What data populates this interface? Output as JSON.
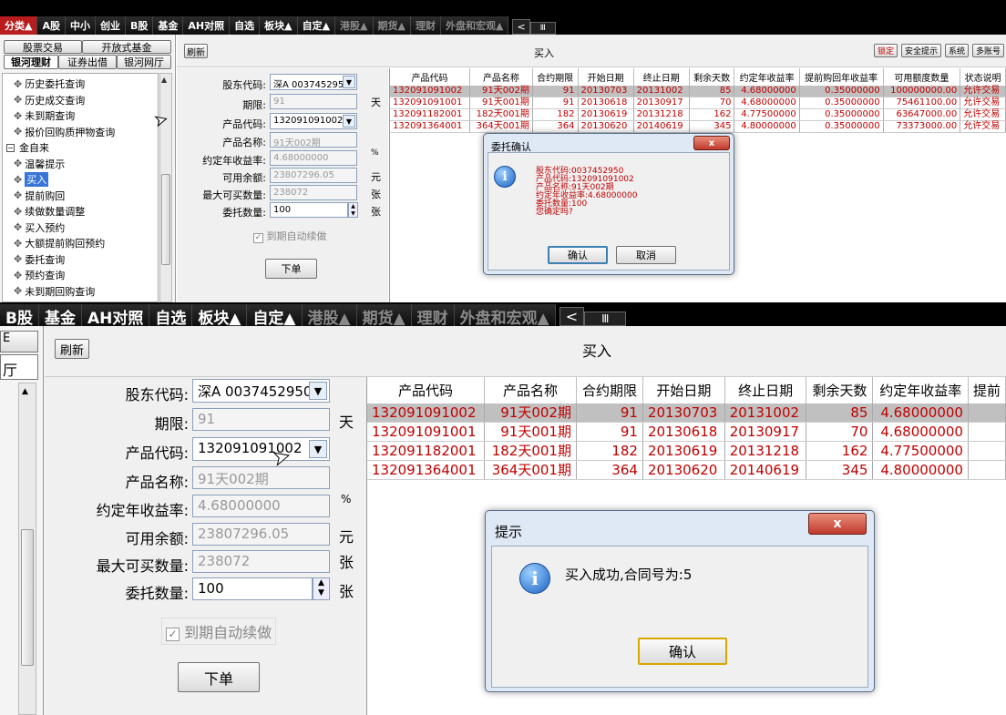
{
  "top": {
    "tabs": [
      {
        "label": "分类▲",
        "active": true
      },
      {
        "label": "A股"
      },
      {
        "label": "中小"
      },
      {
        "label": "创业"
      },
      {
        "label": "B股"
      },
      {
        "label": "基金"
      },
      {
        "label": "AH对照"
      },
      {
        "label": "自选"
      },
      {
        "label": "板块▲"
      },
      {
        "label": "自定▲"
      },
      {
        "label": "港股▲",
        "dim": true
      },
      {
        "label": "期货▲",
        "dim": true
      },
      {
        "label": "理财",
        "dim": true
      },
      {
        "label": "外盘和宏观▲",
        "dim": true
      }
    ],
    "nav_left": "<",
    "nav_mid": "Ⅲ",
    "left_tabs": {
      "row1": [
        "股票交易",
        "开放式基金"
      ],
      "row2": [
        "银河理财",
        "证券出借",
        "银河网厅"
      ]
    },
    "tree": [
      {
        "label": "历史委托查询"
      },
      {
        "label": "历史成交查询"
      },
      {
        "label": "未到期查询"
      },
      {
        "label": "报价回购质押物查询"
      },
      {
        "label": "金自来",
        "group": true
      },
      {
        "label": "温馨提示"
      },
      {
        "label": "买入",
        "selected": true
      },
      {
        "label": "提前购回"
      },
      {
        "label": "续做数量调整"
      },
      {
        "label": "买入预约"
      },
      {
        "label": "大额提前购回预约"
      },
      {
        "label": "委托查询"
      },
      {
        "label": "预约查询"
      },
      {
        "label": "未到期回购查询"
      }
    ],
    "toolbar": {
      "refresh": "刷新",
      "title": "买入",
      "right_buttons": [
        "锁定",
        "安全提示",
        "系统",
        "多账号"
      ]
    },
    "form": {
      "shareholder_label": "股东代码:",
      "shareholder_value": "深A 0037452950",
      "term_label": "期限:",
      "term_value": "91",
      "term_unit": "天",
      "product_code_label": "产品代码:",
      "product_code_value": "132091091002",
      "product_name_label": "产品名称:",
      "product_name_value": "91天002期",
      "rate_label": "约定年收益率:",
      "rate_value": "4.68000000",
      "rate_unit": "%",
      "balance_label": "可用余额:",
      "balance_value": "23807296.05",
      "balance_unit": "元",
      "max_label": "最大可买数量:",
      "max_value": "238072",
      "max_unit": "张",
      "qty_label": "委托数量:",
      "qty_value": "100",
      "qty_unit": "张",
      "auto_renew": "到期自动续做",
      "submit": "下单"
    },
    "table": {
      "headers": [
        "产品代码",
        "产品名称",
        "合约期限",
        "开始日期",
        "终止日期",
        "剩余天数",
        "约定年收益率",
        "提前购回年收益率",
        "可用额度数量",
        "状态说明"
      ],
      "rows": [
        [
          "132091091002",
          "91天002期",
          "91",
          "20130703",
          "20131002",
          "85",
          "4.68000000",
          "0.35000000",
          "100000000.00",
          "允许交易"
        ],
        [
          "132091091001",
          "91天001期",
          "91",
          "20130618",
          "20130917",
          "70",
          "4.68000000",
          "0.35000000",
          "75461100.00",
          "允许交易"
        ],
        [
          "132091182001",
          "182天001期",
          "182",
          "20130619",
          "20131218",
          "162",
          "4.77500000",
          "0.35000000",
          "63647000.00",
          "允许交易"
        ],
        [
          "132091364001",
          "364天001期",
          "364",
          "20130620",
          "20140619",
          "345",
          "4.80000000",
          "0.35000000",
          "73373000.00",
          "允许交易"
        ]
      ]
    },
    "dialog": {
      "title": "委托确认",
      "lines": [
        "股东代码:0037452950",
        "产品代码:132091091002",
        "产品名称:91天002期",
        "约定年收益率:4.68000000",
        "委托数量:100",
        "您确定吗?"
      ],
      "ok": "确认",
      "cancel": "取消"
    }
  },
  "bottom": {
    "tabs": [
      {
        "label": "B股"
      },
      {
        "label": "基金"
      },
      {
        "label": "AH对照"
      },
      {
        "label": "自选"
      },
      {
        "label": "板块▲"
      },
      {
        "label": "自定▲"
      },
      {
        "label": "港股▲",
        "dim": true
      },
      {
        "label": "期货▲",
        "dim": true
      },
      {
        "label": "理财",
        "dim": true
      },
      {
        "label": "外盘和宏观▲",
        "dim": true
      }
    ],
    "left_tab_partial": "厅",
    "left_tab_partial_top": "E",
    "toolbar": {
      "refresh": "刷新",
      "title": "买入"
    },
    "table_headers": [
      "产品代码",
      "产品名称",
      "合约期限",
      "开始日期",
      "终止日期",
      "剩余天数",
      "约定年收益率",
      "提前"
    ],
    "dialog": {
      "title": "提示",
      "message": "买入成功,合同号为:5",
      "ok": "确认"
    }
  },
  "colors": {
    "active_tab": "#b81c1c",
    "row_text": "#c00000",
    "selected_row": "#c0c0c0",
    "accent_red": "#c00000"
  }
}
